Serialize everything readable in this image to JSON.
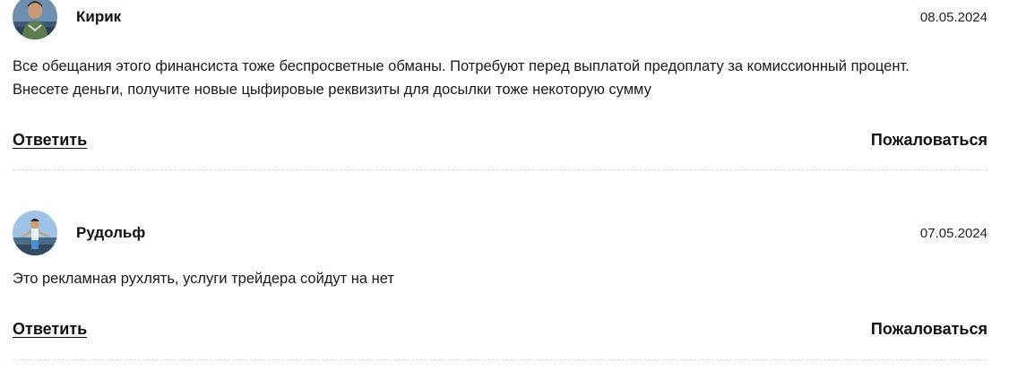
{
  "comments": [
    {
      "author": "Кирик",
      "date": "08.05.2024",
      "text_lines": [
        "Все обещания этого финансиста тоже беспросветные обманы. Потребуют перед выплатой предоплату за комиссионный процент.",
        "Внесете деньги, получите новые цыфировые реквизиты для досылки тоже некоторую сумму"
      ],
      "reply_label": "Ответить",
      "complain_label": "Пожаловаться"
    },
    {
      "author": "Рудольф",
      "date": "07.05.2024",
      "text_lines": [
        "Это рекламная рухлять, услуги трейдера сойдут на нет"
      ],
      "reply_label": "Ответить",
      "complain_label": "Пожаловаться"
    }
  ],
  "icons": {
    "avatar_0": "user-avatar-photo",
    "avatar_1": "user-avatar-photo"
  }
}
